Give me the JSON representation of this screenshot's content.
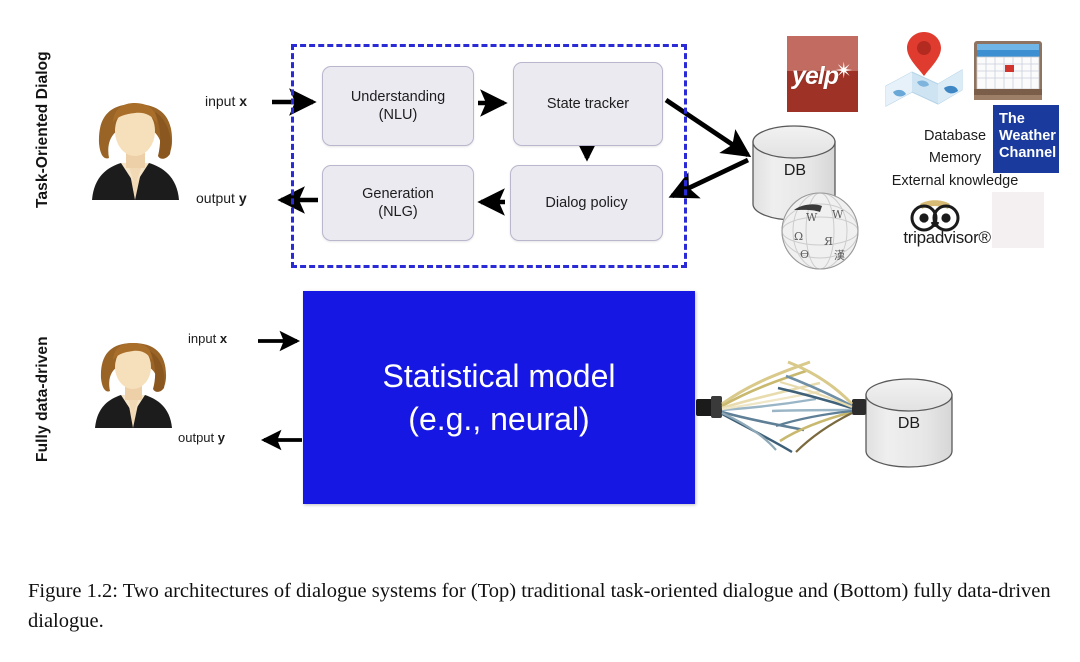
{
  "figure": {
    "caption": "Figure 1.2:  Two architectures of dialogue systems for (Top) traditional task-oriented dialogue and (Bottom) fully data-driven dialogue."
  },
  "rows": {
    "top_label": "Task-Oriented Dialog",
    "bottom_label": "Fully data-driven"
  },
  "top_section": {
    "io": {
      "input_prefix": "input ",
      "input_symbol": "x",
      "output_prefix": "output ",
      "output_symbol": "y"
    },
    "boxes": [
      {
        "id": "nlu",
        "line1": "Understanding",
        "line2": "(NLU)"
      },
      {
        "id": "state",
        "line1": "State tracker",
        "line2": ""
      },
      {
        "id": "policy",
        "line1": "Dialog policy",
        "line2": ""
      },
      {
        "id": "nlg",
        "line1": "Generation",
        "line2": "(NLG)"
      }
    ],
    "database": {
      "label": "DB"
    },
    "knowledge": {
      "line1": "Database",
      "line2": "Memory",
      "line3": "External knowledge"
    },
    "logos": [
      {
        "id": "yelp",
        "name": "yelp-logo",
        "text": "yelp"
      },
      {
        "id": "map",
        "name": "map-icon",
        "text": ""
      },
      {
        "id": "calendar",
        "name": "calendar-icon",
        "text": ""
      },
      {
        "id": "weather",
        "name": "weather-channel-logo",
        "line1": "The",
        "line2": "Weather",
        "line3": "Channel"
      },
      {
        "id": "wikipedia",
        "name": "wikipedia-globe-icon",
        "text": ""
      },
      {
        "id": "tripadvisor",
        "name": "tripadvisor-logo",
        "text": "tripadvisor®"
      },
      {
        "id": "foursquare",
        "name": "foursquare-logo",
        "text": ""
      }
    ]
  },
  "bottom_section": {
    "io": {
      "input_prefix": "input ",
      "input_symbol": "x",
      "output_prefix": "output ",
      "output_symbol": "y"
    },
    "model": {
      "line1": "Statistical model",
      "line2": "(e.g., neural)"
    },
    "database": {
      "label": "DB"
    }
  },
  "colors": {
    "model_blue": "#1717e4",
    "dashed_border_blue": "#2b2bd6",
    "box_fill": "#eceaf1",
    "box_border": "#b9b6cd",
    "weather_blue": "#1a3a9e",
    "yelp_red": "#9e3226",
    "foursquare_pink": "#f94877",
    "db_fill": "#e6e6e6",
    "arrow_black": "#000000",
    "background": "#ffffff"
  }
}
